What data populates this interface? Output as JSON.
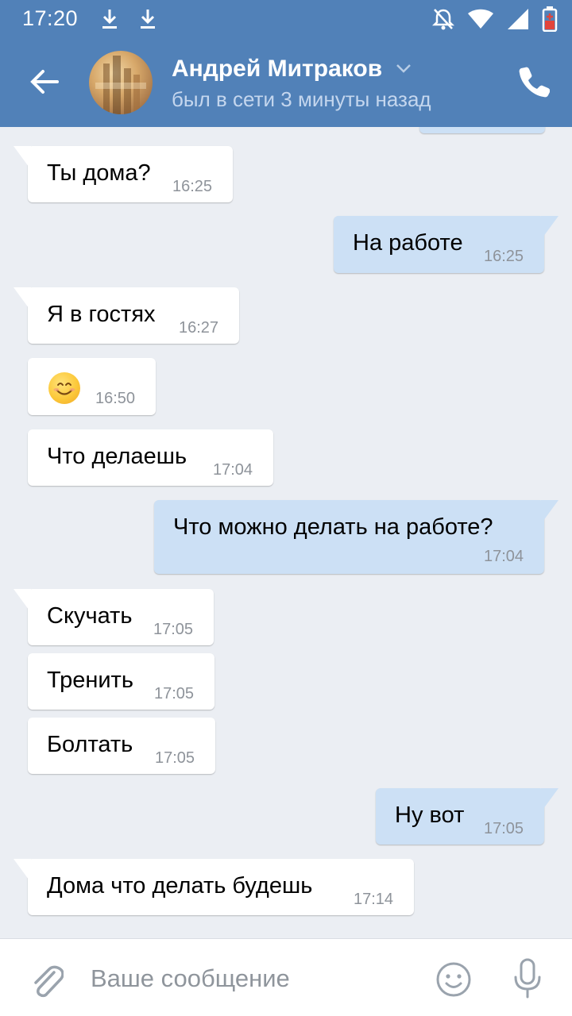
{
  "status_bar": {
    "time": "17:20"
  },
  "header": {
    "contact_name": "Андрей Митраков",
    "contact_status": "был в сети 3 минуты назад"
  },
  "messages": [
    {
      "dir": "in",
      "text": "Ты дома?",
      "time": "16:25"
    },
    {
      "dir": "out",
      "text": "На работе",
      "time": "16:25"
    },
    {
      "dir": "in",
      "text": "Я в гостях",
      "time": "16:27"
    },
    {
      "dir": "in",
      "text": "",
      "emoji": "smiling-face-emoji",
      "time": "16:50"
    },
    {
      "dir": "in",
      "text": "Что делаешь",
      "time": "17:04"
    },
    {
      "dir": "out",
      "text": "Что можно делать на работе?",
      "time": "17:04"
    },
    {
      "dir": "in",
      "text": "Скучать",
      "time": "17:05"
    },
    {
      "dir": "in",
      "text": "Тренить",
      "time": "17:05"
    },
    {
      "dir": "in",
      "text": "Болтать",
      "time": "17:05"
    },
    {
      "dir": "out",
      "text": "Ну вот",
      "time": "17:05"
    },
    {
      "dir": "in",
      "text": "Дома что делать будешь",
      "time": "17:14"
    }
  ],
  "composer": {
    "placeholder": "Ваше сообщение"
  },
  "colors": {
    "header": "#5181b8",
    "incoming": "#ffffff",
    "outgoing": "#cce0f5",
    "background": "#ebeef3"
  }
}
